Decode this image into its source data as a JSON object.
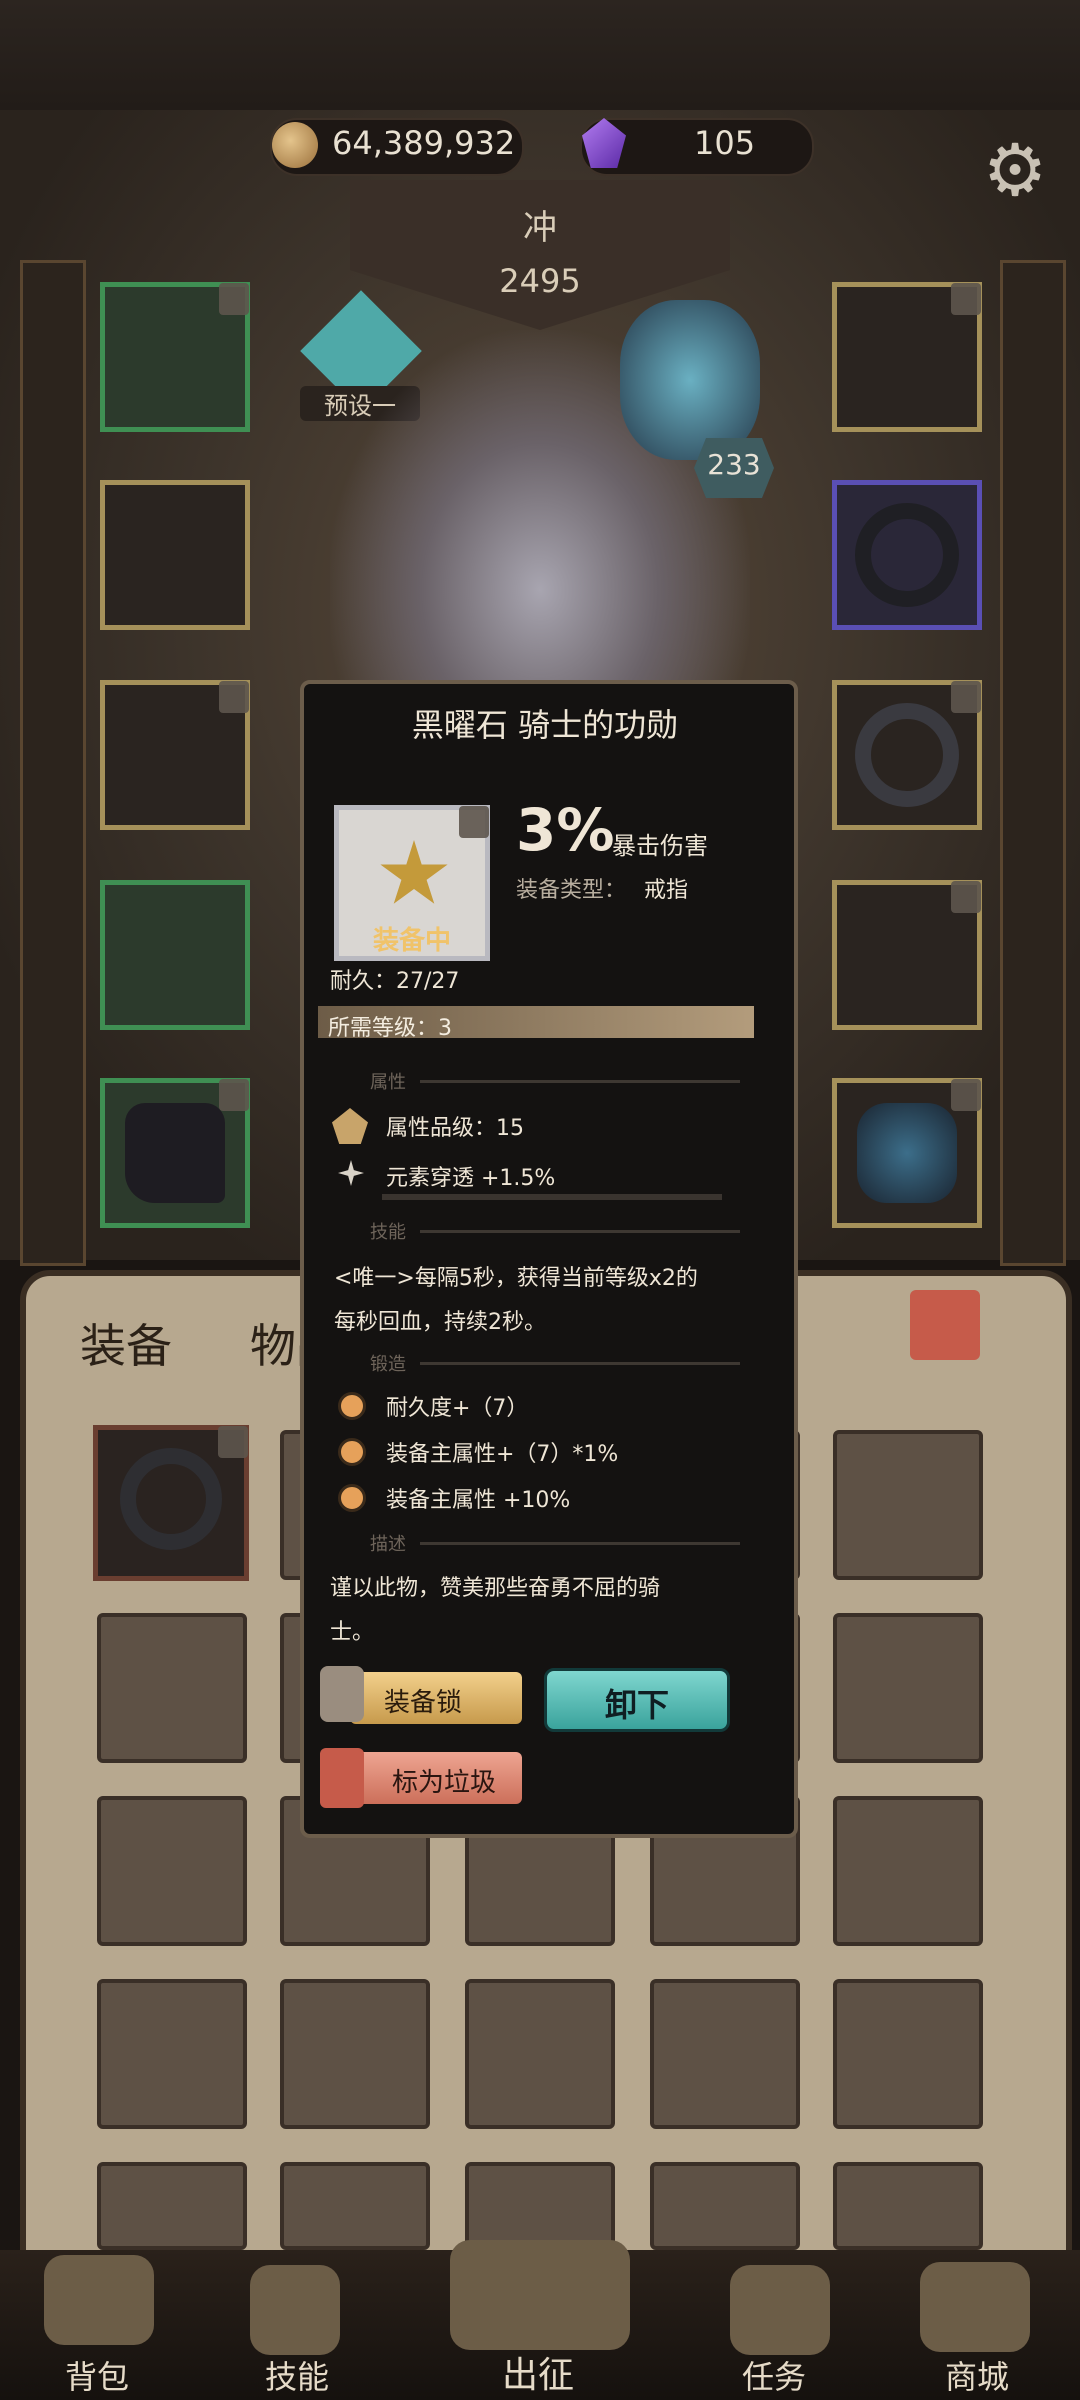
{
  "currency": {
    "gold": "64,389,932",
    "gems": "105"
  },
  "rank": {
    "label": "冲",
    "score": "2495"
  },
  "preset": {
    "label": "预设一"
  },
  "pet_level": "233",
  "colors": {
    "gold_border": "#a5915a",
    "green_border": "#3f8f53",
    "purple_border": "#5a4fb5",
    "accent_teal": "#3aa39c",
    "accent_orange": "#e6a15a"
  },
  "item": {
    "name": "黑曜石 骑士的功勋",
    "value": "3%",
    "stat": "暴击伤害",
    "type_label": "装备类型：",
    "type_value": "戒指",
    "equipped": "装备中",
    "durability": "耐久：27/27",
    "required_level": "所需等级：3",
    "sections": {
      "attr": "属性",
      "skill": "技能",
      "forge": "锻造",
      "desc": "描述"
    },
    "attr_grade": "属性品级：15",
    "attr_elem": "元素穿透 +1.5%",
    "skill_text_1": "<唯一>每隔5秒，获得当前等级x2的",
    "skill_text_2": "每秒回血，持续2秒。",
    "forge": [
      "耐久度+（7）",
      "装备主属性+（7）*1%",
      "装备主属性 +10%"
    ],
    "desc_1": "谨以此物，赞美那些奋勇不屈的骑",
    "desc_2": "士。",
    "lock_button": "装备锁",
    "unequip_button": "卸下",
    "trash_button": "标为垃圾"
  },
  "bag_tabs": {
    "equip": "装备",
    "items": "物品"
  },
  "nav": {
    "bag": "背包",
    "skill": "技能",
    "expedition": "出征",
    "task": "任务",
    "shop": "商城"
  }
}
